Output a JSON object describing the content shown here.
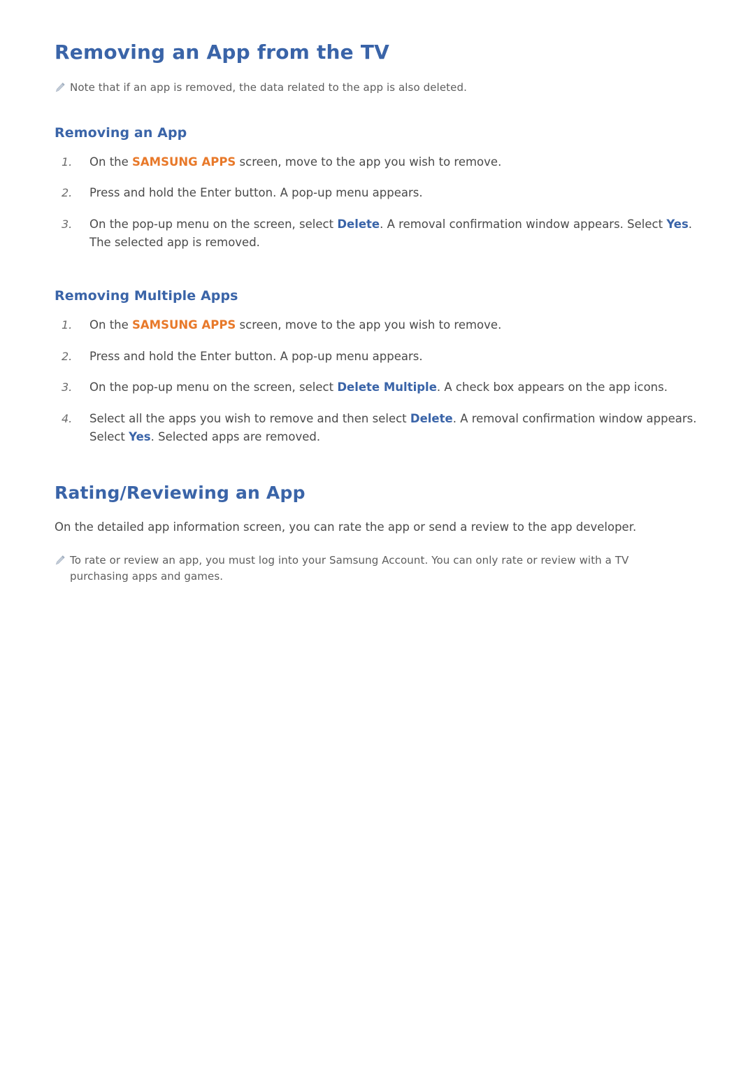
{
  "page": {
    "heading1": "Removing an App from the TV",
    "note1": {
      "icon": "pencil-note-icon",
      "text": "Note that if an app is removed, the data related to the app is also deleted."
    },
    "section1": {
      "heading": "Removing an App",
      "steps": [
        {
          "num": "1.",
          "parts": [
            {
              "t": "On the ",
              "s": "plain"
            },
            {
              "t": "SAMSUNG APPS",
              "s": "orange"
            },
            {
              "t": " screen, move to the app you wish to remove.",
              "s": "plain"
            }
          ]
        },
        {
          "num": "2.",
          "parts": [
            {
              "t": "Press and hold the Enter button. A pop-up menu appears.",
              "s": "plain"
            }
          ]
        },
        {
          "num": "3.",
          "parts": [
            {
              "t": "On the pop-up menu on the screen, select ",
              "s": "plain"
            },
            {
              "t": "Delete",
              "s": "blue"
            },
            {
              "t": ". A removal confirmation window appears. Select ",
              "s": "plain"
            },
            {
              "t": "Yes",
              "s": "blue"
            },
            {
              "t": ". The selected app is removed.",
              "s": "plain"
            }
          ]
        }
      ]
    },
    "section2": {
      "heading": "Removing Multiple Apps",
      "steps": [
        {
          "num": "1.",
          "parts": [
            {
              "t": "On the ",
              "s": "plain"
            },
            {
              "t": "SAMSUNG APPS",
              "s": "orange"
            },
            {
              "t": " screen, move to the app you wish to remove.",
              "s": "plain"
            }
          ]
        },
        {
          "num": "2.",
          "parts": [
            {
              "t": "Press and hold the Enter button. A pop-up menu appears.",
              "s": "plain"
            }
          ]
        },
        {
          "num": "3.",
          "parts": [
            {
              "t": "On the pop-up menu on the screen, select ",
              "s": "plain"
            },
            {
              "t": "Delete Multiple",
              "s": "blue"
            },
            {
              "t": ". A check box appears on the app icons.",
              "s": "plain"
            }
          ]
        },
        {
          "num": "4.",
          "parts": [
            {
              "t": "Select all the apps you wish to remove and then select ",
              "s": "plain"
            },
            {
              "t": "Delete",
              "s": "blue"
            },
            {
              "t": ". A removal confirmation window appears. Select ",
              "s": "plain"
            },
            {
              "t": "Yes",
              "s": "blue"
            },
            {
              "t": ". Selected apps are removed.",
              "s": "plain"
            }
          ]
        }
      ]
    },
    "heading2": "Rating/Reviewing an App",
    "paragraph1": "On the detailed app information screen, you can rate the app or send a review to the app developer.",
    "note2": {
      "icon": "pencil-note-icon",
      "text": "To rate or review an app, you must log into your Samsung Account. You can only rate or review with a TV purchasing apps and games."
    }
  },
  "colors": {
    "heading": "#3a64a8",
    "keyword_orange": "#e8792a",
    "keyword_blue": "#3a64a8",
    "body_text": "#4a4a4a",
    "note_text": "#5d5d5d"
  }
}
